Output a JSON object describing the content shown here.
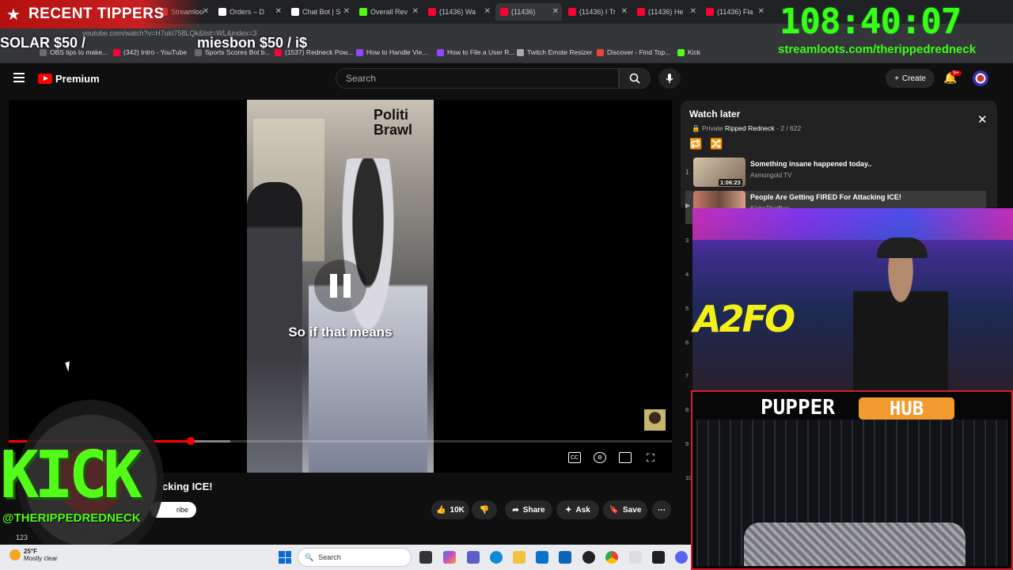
{
  "browser": {
    "tabs": [
      {
        "label": "Streamloo",
        "color": "#e8453c"
      },
      {
        "label": "Orders – D",
        "color": "#fff"
      },
      {
        "label": "Chat Bot | S",
        "color": "#fff"
      },
      {
        "label": "Overall Rev",
        "color": "#53fc18"
      },
      {
        "label": "(11436) Wa",
        "color": "#ff0033"
      },
      {
        "label": "(11436)",
        "color": "#ff0033"
      },
      {
        "label": "(11436) I Tr",
        "color": "#ff0033"
      },
      {
        "label": "(11436) He",
        "color": "#ff0033"
      },
      {
        "label": "(11436) Fla",
        "color": "#ff0033"
      }
    ],
    "url": "youtube.com/watch?v=H7ukl758LQk&list=WL&index=3",
    "bookmarks": [
      {
        "label": "OBS tips to make...",
        "color": "#6b6b6b"
      },
      {
        "label": "(342) Intro - YouTube",
        "color": "#ff0033"
      },
      {
        "label": "Sports Scores Bot b...",
        "color": "#6b6b6b"
      },
      {
        "label": "(1537) Redneck Pow...",
        "color": "#ff0033"
      },
      {
        "label": "How to Handle Vie...",
        "color": "#9146ff"
      },
      {
        "label": "How to File a User R...",
        "color": "#9146ff"
      },
      {
        "label": "Twitch Emote Resizer",
        "color": "#aaaaaa"
      },
      {
        "label": "Discover - Find Top...",
        "color": "#e8453c"
      },
      {
        "label": "Kick",
        "color": "#53fc18"
      }
    ]
  },
  "overlays": {
    "tippers_title": "RECENT TIPPERS",
    "tipper_1": "SOLAR $50 /",
    "tipper_2": "miesbon $50 / i$",
    "timer": "108:40:07",
    "timer_url": "streamloots.com/therippedredneck",
    "kick_logo": "KICK",
    "kick_handle": "@THERIPPEDREDNECK",
    "pupper_name": "PUPPER",
    "pupper_hub": "HUB",
    "cam_sign": "A2FO"
  },
  "youtube": {
    "brand": "Premium",
    "search_placeholder": "Search",
    "create_label": "Create",
    "notif_count": "9+",
    "video": {
      "brand_overlay": "Politi\nBrawl",
      "caption": "So if that means",
      "progress": 0.275,
      "title_fragment": "cking ICE!",
      "subscribe_fragment": "ribe",
      "like_count": "10K",
      "share_label": "Share",
      "ask_label": "Ask",
      "save_label": "Save",
      "view_fragment": "123"
    },
    "watch_later": {
      "title": "Watch later",
      "meta_private": "Private",
      "meta_owner": "Ripped Redneck",
      "meta_position": "- 2 / 622",
      "items": [
        {
          "index": "1",
          "title": "Something insane happened today..",
          "channel": "Asmongold TV",
          "duration": "1:06:23"
        },
        {
          "index": "",
          "title": "People Are Getting FIRED For Attacking ICE!",
          "channel": "KickeThatBox",
          "duration": ""
        }
      ],
      "row_indices": [
        "3",
        "4",
        "5",
        "6",
        "7",
        "8",
        "9",
        "10"
      ]
    }
  },
  "taskbar": {
    "temp": "25°F",
    "condition": "Mostly clear",
    "search_label": "Search"
  },
  "colors": {
    "accent_red": "#ff0000",
    "kick_green": "#53fc18",
    "timer_green": "#39ff14"
  }
}
